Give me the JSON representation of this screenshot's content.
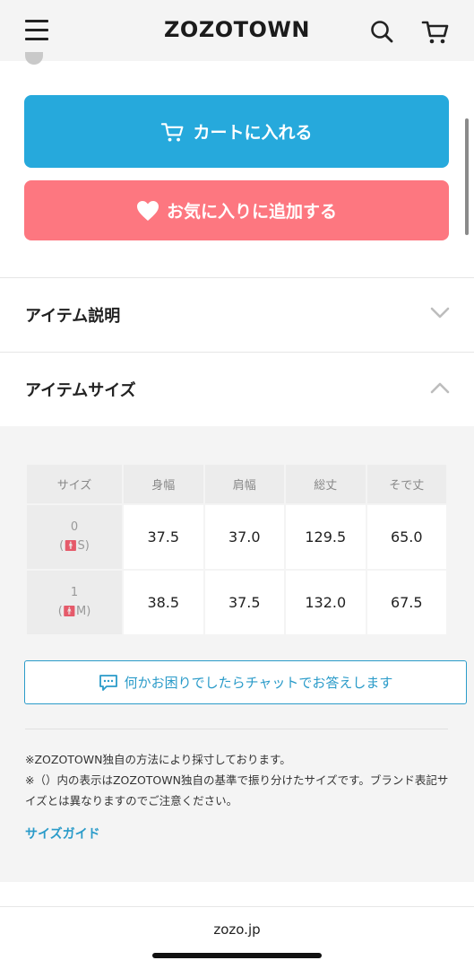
{
  "header": {
    "logo": "ZOZOTOWN",
    "menu_icon": "hamburger-icon",
    "search_icon": "search-icon",
    "cart_icon": "cart-icon"
  },
  "actions": {
    "cart_label": "カートに入れる",
    "favorite_label": "お気に入りに追加する",
    "cart_color": "#26a9dc",
    "favorite_color": "#fd7780"
  },
  "accordions": [
    {
      "label": "アイテム説明",
      "state": "collapsed"
    },
    {
      "label": "アイテムサイズ",
      "state": "expanded"
    }
  ],
  "size_table": {
    "headers": [
      "サイズ",
      "身幅",
      "肩幅",
      "総丈",
      "そで丈"
    ],
    "rows": [
      {
        "size": "0",
        "label": "S",
        "values": [
          "37.5",
          "37.0",
          "129.5",
          "65.0"
        ]
      },
      {
        "size": "1",
        "label": "M",
        "values": [
          "38.5",
          "37.5",
          "132.0",
          "67.5"
        ]
      }
    ]
  },
  "chat": {
    "label": "何かお困りでしたらチャットでお答えします"
  },
  "notes": [
    "※ZOZOTOWN独自の方法により採寸しております。",
    "※（）内の表示はZOZOTOWN独自の基準で振り分けたサイズです。ブランド表記サイズとは異なりますのでご注意ください。"
  ],
  "size_guide": "サイズガイド",
  "footer": {
    "url": "zozo.jp"
  }
}
